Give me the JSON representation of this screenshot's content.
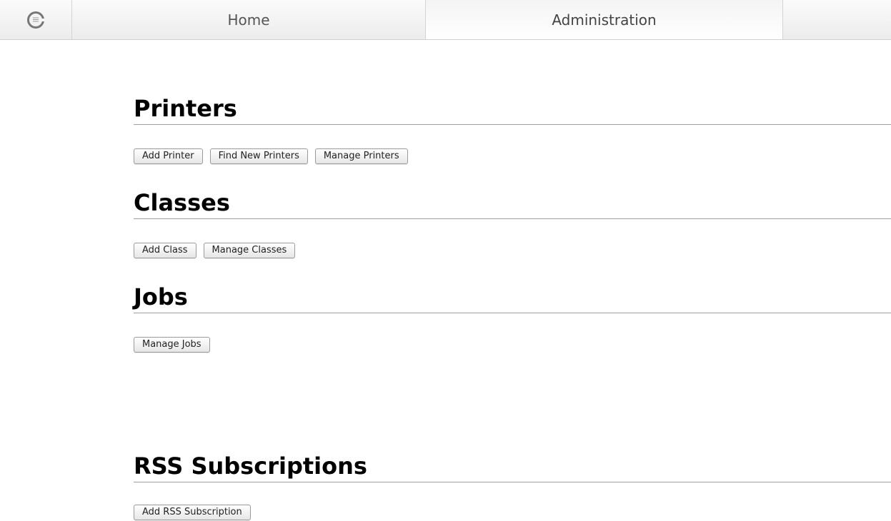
{
  "nav": {
    "logo_icon": "cups-logo-icon",
    "tabs": [
      {
        "label": "Home"
      },
      {
        "label": "Administration"
      }
    ]
  },
  "sections": {
    "printers": {
      "title": "Printers",
      "buttons": [
        "Add Printer",
        "Find New Printers",
        "Manage Printers"
      ]
    },
    "classes": {
      "title": "Classes",
      "buttons": [
        "Add Class",
        "Manage Classes"
      ]
    },
    "jobs": {
      "title": "Jobs",
      "buttons": [
        "Manage Jobs"
      ]
    },
    "rss": {
      "title": "RSS Subscriptions",
      "buttons": [
        "Add RSS Subscription"
      ]
    }
  }
}
